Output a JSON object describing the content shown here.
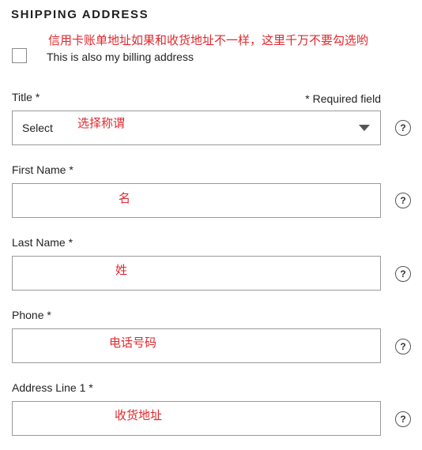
{
  "section": {
    "heading": "SHIPPING ADDRESS",
    "billing_note": "信用卡账单地址如果和收货地址不一样，这里千万不要勾选哟",
    "billing_checkbox_label": "This is also my billing address",
    "billing_checked": false,
    "required_note": "* Required field"
  },
  "fields": {
    "title": {
      "label": "Title *",
      "value": "Select",
      "note": "选择称谓",
      "help": "?"
    },
    "first_name": {
      "label": "First Name *",
      "value": "",
      "note": "名",
      "help": "?"
    },
    "last_name": {
      "label": "Last Name *",
      "value": "",
      "note": "姓",
      "help": "?"
    },
    "phone": {
      "label": "Phone *",
      "value": "",
      "note": "电话号码",
      "help": "?"
    },
    "address1": {
      "label": "Address Line 1 *",
      "value": "",
      "note": "收货地址",
      "help": "?"
    }
  },
  "colors": {
    "annotation": "#e0282e",
    "border": "#9a9a9a"
  }
}
